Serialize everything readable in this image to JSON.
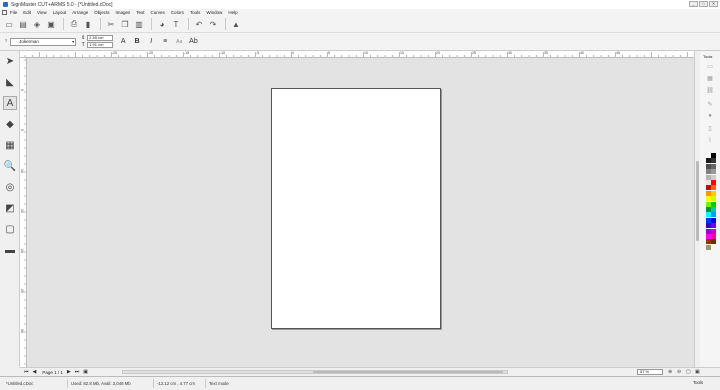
{
  "window": {
    "title": "SignMaster CUT+ARMS 5.0 - [*Untitled.cDoc]",
    "controls": [
      "_",
      "□",
      "✕"
    ]
  },
  "menu": [
    "File",
    "Edit",
    "View",
    "Layout",
    "Arrange",
    "Objects",
    "Images",
    "Text",
    "Curves",
    "Colors",
    "Tools",
    "Window",
    "Help"
  ],
  "text_toolbar": {
    "font_name": "Jokerman",
    "height_value": "2.55 cm",
    "width_value": "1.91 cm",
    "bold_label": "B",
    "italic_label": "I",
    "align_label": "Aa"
  },
  "rulers": {
    "top": [
      "-25",
      "-20",
      "-15",
      "-10",
      "-5",
      "0",
      "5",
      "10",
      "15",
      "20",
      "25",
      "30",
      "35",
      "40",
      "45"
    ],
    "left": [
      "0",
      "5",
      "10",
      "15",
      "20",
      "25",
      "30"
    ]
  },
  "right_panel": {
    "label": "Tools",
    "bottom_label": "Tools"
  },
  "palette": [
    "#ffffff",
    "#000000",
    "#1a1a1a",
    "#333333",
    "#4d4d4d",
    "#666666",
    "#808080",
    "#999999",
    "#b3b3b3",
    "#cccccc",
    "#e6e6e6",
    "#ff0000",
    "#cc0000",
    "#ff6600",
    "#ff9900",
    "#ffcc00",
    "#ffff00",
    "#ccff00",
    "#66ff00",
    "#00cc00",
    "#009933",
    "#00cc99",
    "#00ffff",
    "#0099ff",
    "#0033ff",
    "#0000cc",
    "#3300cc",
    "#6600ff",
    "#9900cc",
    "#cc00cc",
    "#ff00ff",
    "#ff0099",
    "#993300",
    "#663300",
    "#999966"
  ],
  "pager": {
    "page_label": "Page 1 / 1",
    "zoom": "57 %"
  },
  "status": {
    "file": "*Untitled.cDoc",
    "memory": "Used: 82.8 Mb, Avail: 2,048 Mb",
    "coords": "-12.12 cm , 4.77 cm",
    "mode": "Text mode"
  },
  "colors": {
    "page": "#ffffff",
    "canvas": "#e3e3e3",
    "chrome": "#f0f0f0"
  }
}
